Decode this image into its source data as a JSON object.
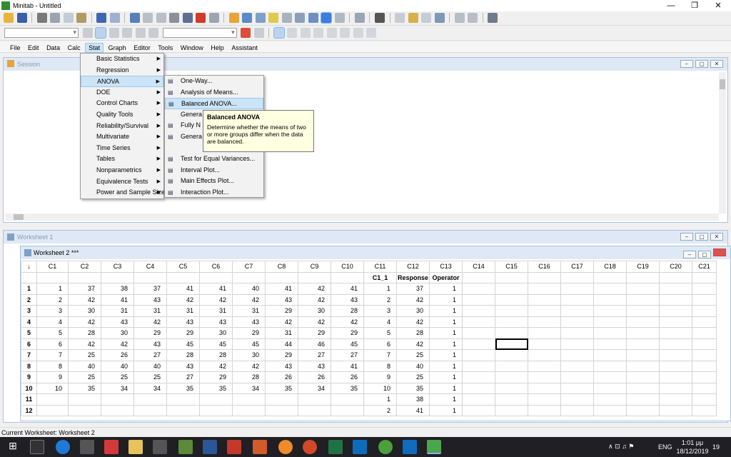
{
  "window": {
    "title": "Minitab - Untitled",
    "minimize": "—",
    "restore": "❐",
    "close": "✕"
  },
  "menubar": [
    "File",
    "Edit",
    "Data",
    "Calc",
    "Stat",
    "Graph",
    "Editor",
    "Tools",
    "Window",
    "Help",
    "Assistant"
  ],
  "session": {
    "title": "Session"
  },
  "worksheet1": {
    "title": "Worksheet 1"
  },
  "worksheet2": {
    "title": "Worksheet 2 ***",
    "columns": [
      "C1",
      "C2",
      "C3",
      "C4",
      "C5",
      "C6",
      "C7",
      "C8",
      "C9",
      "C10",
      "C11",
      "C12",
      "C13",
      "C14",
      "C15",
      "C16",
      "C17",
      "C18",
      "C19",
      "C20",
      "C21"
    ],
    "names": [
      "",
      "",
      "",
      "",
      "",
      "",
      "",
      "",
      "",
      "",
      "C1_1",
      "Response",
      "Operator",
      "",
      "",
      "",
      "",
      "",
      "",
      "",
      ""
    ],
    "rows": [
      {
        "n": "1",
        "v": [
          "1",
          "37",
          "38",
          "37",
          "41",
          "41",
          "40",
          "41",
          "42",
          "41",
          "1",
          "37",
          "1"
        ]
      },
      {
        "n": "2",
        "v": [
          "2",
          "42",
          "41",
          "43",
          "42",
          "42",
          "42",
          "43",
          "42",
          "43",
          "2",
          "42",
          "1"
        ]
      },
      {
        "n": "3",
        "v": [
          "3",
          "30",
          "31",
          "31",
          "31",
          "31",
          "31",
          "29",
          "30",
          "28",
          "3",
          "30",
          "1"
        ]
      },
      {
        "n": "4",
        "v": [
          "4",
          "42",
          "43",
          "42",
          "43",
          "43",
          "43",
          "42",
          "42",
          "42",
          "4",
          "42",
          "1"
        ]
      },
      {
        "n": "5",
        "v": [
          "5",
          "28",
          "30",
          "29",
          "29",
          "30",
          "29",
          "31",
          "29",
          "29",
          "5",
          "28",
          "1"
        ]
      },
      {
        "n": "6",
        "v": [
          "6",
          "42",
          "42",
          "43",
          "45",
          "45",
          "45",
          "44",
          "46",
          "45",
          "6",
          "42",
          "1"
        ]
      },
      {
        "n": "7",
        "v": [
          "7",
          "25",
          "26",
          "27",
          "28",
          "28",
          "30",
          "29",
          "27",
          "27",
          "7",
          "25",
          "1"
        ]
      },
      {
        "n": "8",
        "v": [
          "8",
          "40",
          "40",
          "40",
          "43",
          "42",
          "42",
          "43",
          "43",
          "41",
          "8",
          "40",
          "1"
        ]
      },
      {
        "n": "9",
        "v": [
          "9",
          "25",
          "25",
          "25",
          "27",
          "29",
          "28",
          "26",
          "26",
          "26",
          "9",
          "25",
          "1"
        ]
      },
      {
        "n": "10",
        "v": [
          "10",
          "35",
          "34",
          "34",
          "35",
          "35",
          "34",
          "35",
          "34",
          "35",
          "10",
          "35",
          "1"
        ]
      },
      {
        "n": "11",
        "v": [
          "",
          "",
          "",
          "",
          "",
          "",
          "",
          "",
          "",
          "",
          "1",
          "38",
          "1"
        ]
      },
      {
        "n": "12",
        "v": [
          "",
          "",
          "",
          "",
          "",
          "",
          "",
          "",
          "",
          "",
          "2",
          "41",
          "1"
        ]
      }
    ]
  },
  "stat_menu": [
    {
      "label": "Basic Statistics",
      "sub": true
    },
    {
      "label": "Regression",
      "sub": true
    },
    {
      "label": "ANOVA",
      "sub": true,
      "active": true
    },
    {
      "label": "DOE",
      "sub": true
    },
    {
      "label": "Control Charts",
      "sub": true
    },
    {
      "label": "Quality Tools",
      "sub": true
    },
    {
      "label": "Reliability/Survival",
      "sub": true
    },
    {
      "label": "Multivariate",
      "sub": true
    },
    {
      "label": "Time Series",
      "sub": true
    },
    {
      "label": "Tables",
      "sub": true
    },
    {
      "label": "Nonparametrics",
      "sub": true
    },
    {
      "label": "Equivalence Tests",
      "sub": true
    },
    {
      "label": "Power and Sample Size",
      "sub": true
    }
  ],
  "anova_menu": [
    {
      "label": "One-Way...",
      "icon": "one-way-icon"
    },
    {
      "label": "Analysis of Means...",
      "icon": "analysis-of-means-icon"
    },
    {
      "label": "Balanced ANOVA...",
      "icon": "balanced-anova-icon",
      "active": true
    },
    {
      "label": "Genera",
      "icon": ""
    },
    {
      "label": "Fully N",
      "icon": "fully-nested-icon"
    },
    {
      "label": "Genera",
      "icon": "general-multivariate-icon"
    },
    {
      "label": "",
      "icon": ""
    },
    {
      "label": "Test for Equal Variances...",
      "icon": "equal-variances-icon"
    },
    {
      "label": "Interval Plot...",
      "icon": "interval-plot-icon"
    },
    {
      "label": "Main Effects Plot...",
      "icon": "main-effects-icon"
    },
    {
      "label": "Interaction Plot...",
      "icon": "interaction-plot-icon"
    }
  ],
  "tooltip": {
    "title": "Balanced ANOVA",
    "body": "Determine whether the means of two or more groups differ when the data are balanced."
  },
  "statusbar": {
    "text": "Current Worksheet: Worksheet 2"
  },
  "taskbar": {
    "lang": "ENG",
    "time": "1:01 μμ",
    "date": "18/12/2019",
    "notifications": "19"
  }
}
